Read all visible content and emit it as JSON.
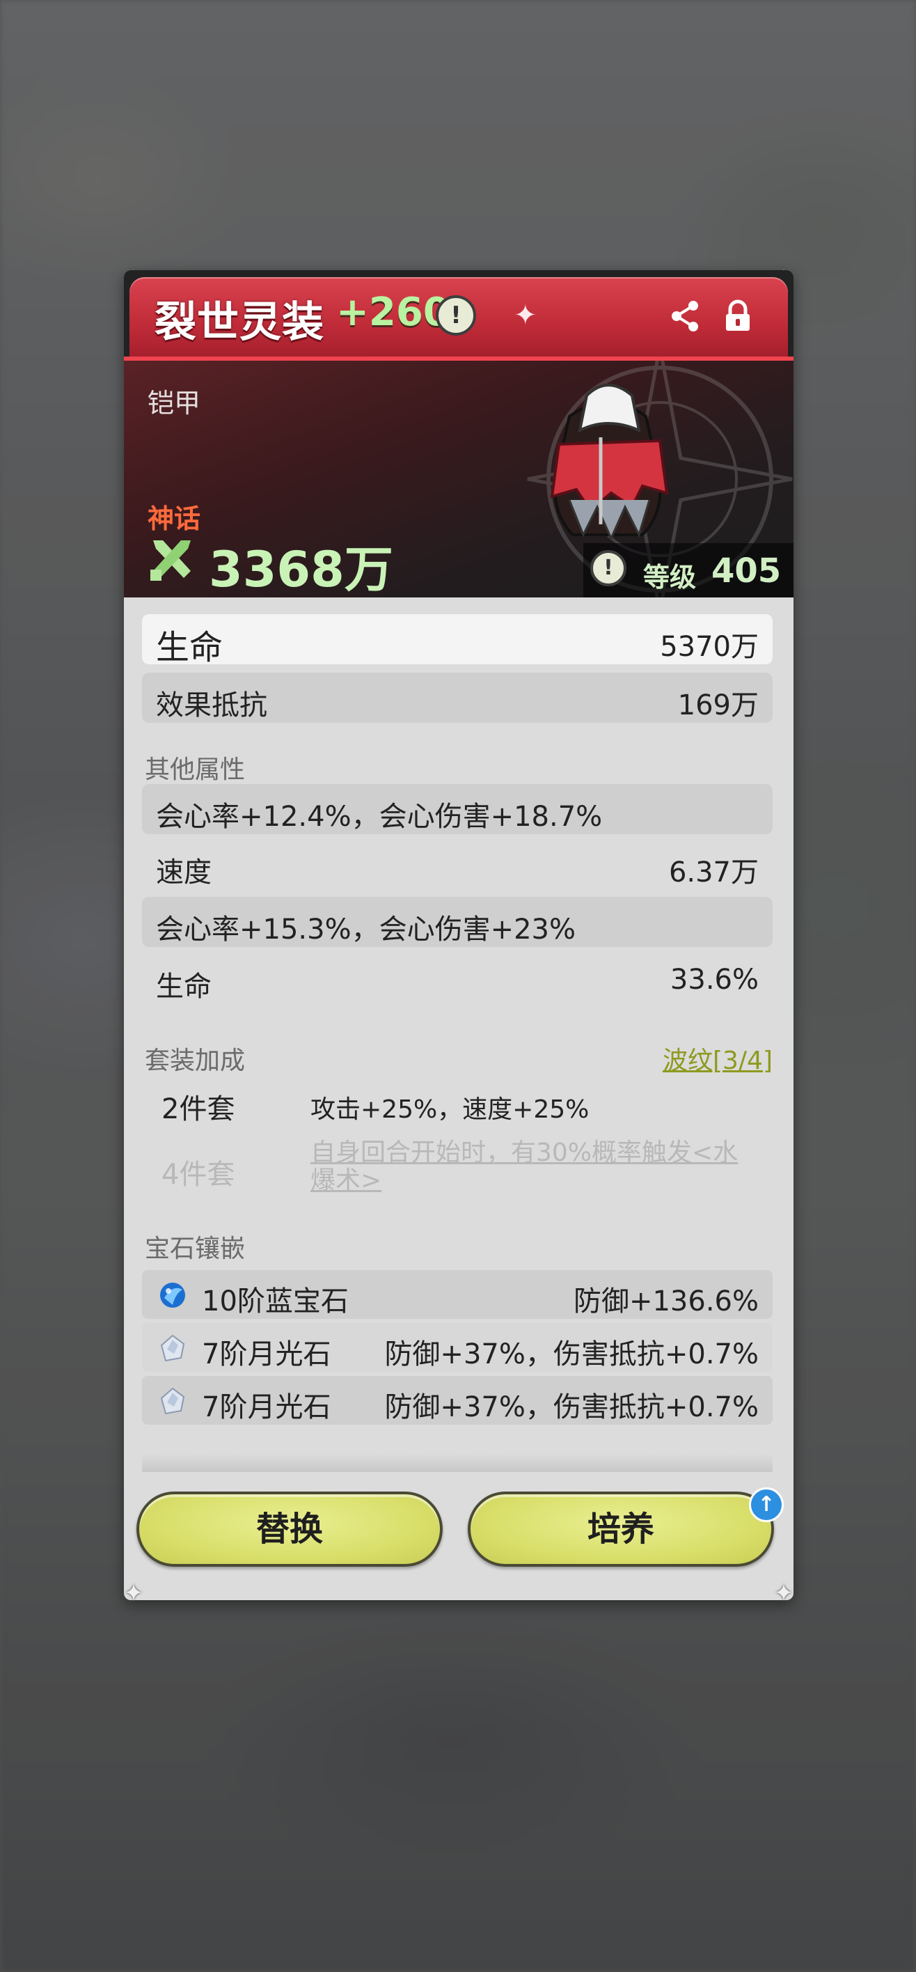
{
  "header": {
    "title": "裂世灵装",
    "enhance": "+260",
    "info_glyph": "!",
    "icons": [
      "share-icon",
      "lock-icon"
    ]
  },
  "banner": {
    "type": "铠甲",
    "rarity": "神话",
    "power": "3368万",
    "level_label": "等级",
    "level_value": "405",
    "info_glyph": "!"
  },
  "main_stats": [
    {
      "label": "生命",
      "value": "5370万"
    },
    {
      "label": "效果抵抗",
      "value": "169万"
    }
  ],
  "other_attrs": {
    "title": "其他属性",
    "rows": [
      {
        "label": "会心率+12.4%，会心伤害+18.7%",
        "value": ""
      },
      {
        "label": "速度",
        "value": "6.37万"
      },
      {
        "label": "会心率+15.3%，会心伤害+23%",
        "value": ""
      },
      {
        "label": "生命",
        "value": "33.6%"
      }
    ]
  },
  "set_bonus": {
    "title": "套装加成",
    "set_link": "波纹[3/4]",
    "items": [
      {
        "name": "2件套",
        "desc": "攻击+25%，速度+25%",
        "active": true
      },
      {
        "name": "4件套",
        "desc": "自身回合开始时，有30%概率触发<水爆术>",
        "active": false
      }
    ]
  },
  "gems": {
    "title": "宝石镶嵌",
    "items": [
      {
        "name": "10阶蓝宝石",
        "effect": "防御+136.6%",
        "icon": "sapphire-icon"
      },
      {
        "name": "7阶月光石",
        "effect": "防御+37%，伤害抵抗+0.7%",
        "icon": "moonstone-icon"
      },
      {
        "name": "7阶月光石",
        "effect": "防御+37%，伤害抵抗+0.7%",
        "icon": "moonstone-icon"
      }
    ]
  },
  "buttons": {
    "replace": "替换",
    "train": "培养",
    "upgrade_badge": "↑"
  },
  "colors": {
    "header_red": "#c02b38",
    "rarity_orange": "#ff6a3c",
    "power_green": "#c9f3b6",
    "button_yellow": "#d9df6a",
    "set_link_olive": "#8e9a1f"
  }
}
